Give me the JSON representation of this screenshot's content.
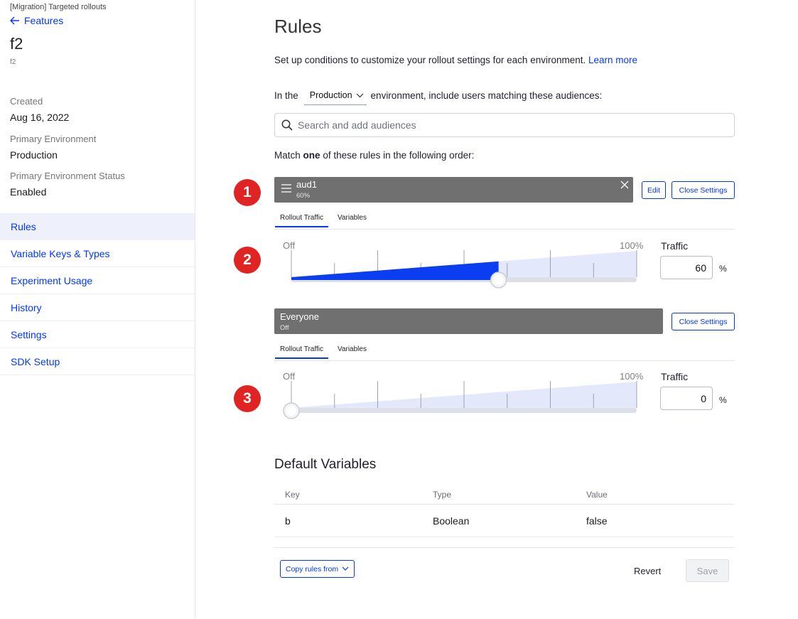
{
  "colors": {
    "accent": "#0037ff",
    "rule_bar": "#707070",
    "badge": "#e02424",
    "slider_fill": "#0a3ef0",
    "slider_track": "#e3e8fb"
  },
  "sidebar": {
    "project_name": "[Migration] Targeted rollouts",
    "back_link": "Features",
    "feature_title": "f2",
    "feature_key": "f2",
    "meta": [
      {
        "label": "Created",
        "value": "Aug 16, 2022"
      },
      {
        "label": "Primary Environment",
        "value": "Production"
      },
      {
        "label": "Primary Environment Status",
        "value": "Enabled"
      }
    ],
    "nav": [
      {
        "label": "Rules",
        "active": true
      },
      {
        "label": "Variable Keys & Types",
        "active": false
      },
      {
        "label": "Experiment Usage",
        "active": false
      },
      {
        "label": "History",
        "active": false
      },
      {
        "label": "Settings",
        "active": false
      },
      {
        "label": "SDK Setup",
        "active": false
      }
    ]
  },
  "main": {
    "title": "Rules",
    "intro_text": "Set up conditions to customize your rollout settings for each environment.",
    "learn_more": "Learn more",
    "env_prefix": "In the",
    "env_value": "Production",
    "env_suffix": "environment, include users matching these audiences:",
    "search_placeholder": "Search and add audiences",
    "match_prefix": "Match",
    "match_bold": "one",
    "match_suffix": "of these rules in the following order:",
    "tabs": [
      "Rollout Traffic",
      "Variables"
    ],
    "slider_off_label": "Off",
    "slider_max_label": "100%",
    "traffic_label": "Traffic",
    "percent_sign": "%",
    "rules": [
      {
        "badge": "1",
        "name": "aud1",
        "sub": "60%",
        "edit_label": "Edit",
        "close_settings_label": "Close Settings"
      },
      {
        "name": "Everyone",
        "sub": "Off",
        "close_settings_label": "Close Settings"
      }
    ],
    "sliders": [
      {
        "badge": "2",
        "traffic": 60
      },
      {
        "badge": "3",
        "traffic": 0
      }
    ],
    "default_variables": {
      "title": "Default Variables",
      "columns": [
        "Key",
        "Type",
        "Value"
      ],
      "rows": [
        [
          "b",
          "Boolean",
          "false"
        ]
      ]
    },
    "footer": {
      "copy_rules": "Copy rules from",
      "revert": "Revert",
      "save": "Save"
    }
  }
}
